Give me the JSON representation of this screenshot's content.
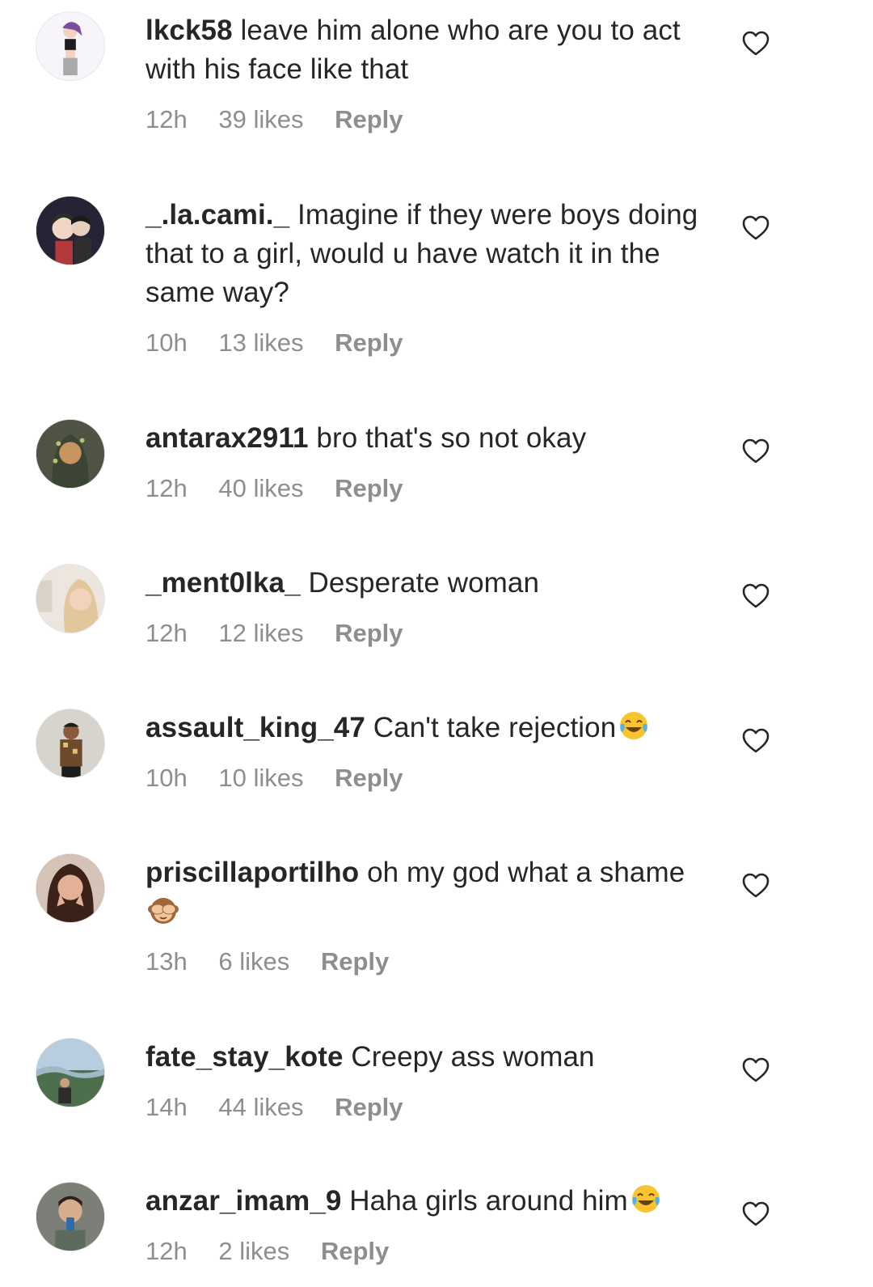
{
  "comments": [
    {
      "username": "lkck58",
      "text": "leave him alone who are you to act with his face like that",
      "time": "12h",
      "likes": "39 likes",
      "reply": "Reply",
      "avatar_color": "#f2f0f6"
    },
    {
      "username": "_.la.cami._",
      "text": "Imagine if they were boys doing that to a girl, would u have watch it in the same way?",
      "time": "10h",
      "likes": "13 likes",
      "reply": "Reply",
      "avatar_color": "#2a1f3a"
    },
    {
      "username": "antarax2911",
      "text": "bro that's so not okay",
      "time": "12h",
      "likes": "40 likes",
      "reply": "Reply",
      "avatar_color": "#5b5a4a"
    },
    {
      "username": "_ment0lka_",
      "text": "Desperate woman",
      "time": "12h",
      "likes": "12 likes",
      "reply": "Reply",
      "avatar_color": "#e8ddd2"
    },
    {
      "username": "assault_king_47",
      "text": "Can't take rejection",
      "emoji": "face-with-tears-of-joy",
      "time": "10h",
      "likes": "10 likes",
      "reply": "Reply",
      "avatar_color": "#c9c4bd"
    },
    {
      "username": "priscillaportilho",
      "text": "oh my god what a shame",
      "emoji": "see-no-evil-monkey",
      "time": "13h",
      "likes": "6 likes",
      "reply": "Reply",
      "avatar_color": "#8a5a48"
    },
    {
      "username": "fate_stay_kote",
      "text": "Creepy ass woman",
      "time": "14h",
      "likes": "44 likes",
      "reply": "Reply",
      "avatar_color": "#7f9a8c"
    },
    {
      "username": "anzar_imam_9",
      "text": "Haha girls around him",
      "emoji": "face-with-tears-of-joy",
      "time": "12h",
      "likes": "2 likes",
      "reply": "Reply",
      "avatar_color": "#6b6f6a"
    }
  ],
  "icons": {
    "like": "heart-outline-icon"
  }
}
